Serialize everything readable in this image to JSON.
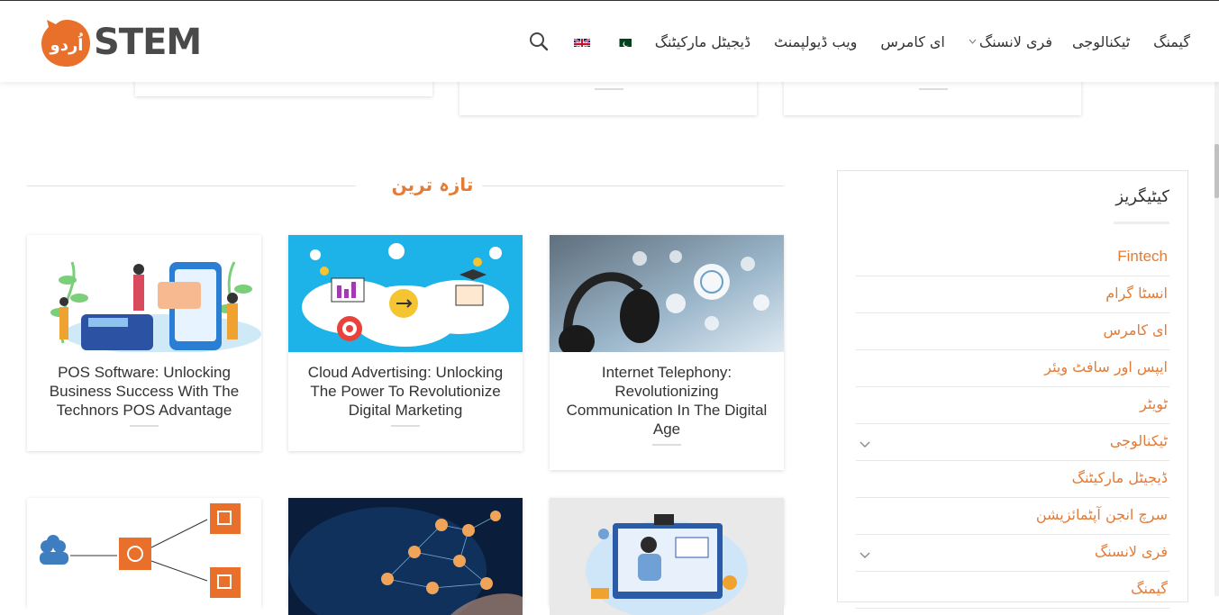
{
  "header": {
    "logo_text": "STEM",
    "logo_badge_text": "اُردو",
    "brand_color": "#e57b35",
    "nav": [
      {
        "label": "گیمنگ",
        "has_dropdown": false
      },
      {
        "label": "ٹیکنالوجی",
        "has_dropdown": false
      },
      {
        "label": "فری لانسنگ",
        "has_dropdown": true
      },
      {
        "label": "ای کامرس",
        "has_dropdown": false
      },
      {
        "label": "ویب ڈیولپمنٹ",
        "has_dropdown": false
      },
      {
        "label": "ڈیجیٹل مارکیٹنگ",
        "has_dropdown": false
      }
    ],
    "flags": [
      "pakistan-flag-icon",
      "uk-flag-icon"
    ],
    "search_icon": "search-icon"
  },
  "latest": {
    "title": "تازہ ترین",
    "posts": [
      {
        "title": "POS Software: Unlocking Business Success With The Technors POS Advantage",
        "image": "payment-terminal-illustration"
      },
      {
        "title": "Cloud Advertising: Unlocking The Power To Revolutionize Digital Marketing",
        "image": "cloud-marketing-illustration"
      },
      {
        "title": "Internet Telephony: Revolutionizing Communication In The Digital Age",
        "image": "headset-photo"
      },
      {
        "title": "",
        "image": "load-balancer-diagram"
      },
      {
        "title": "",
        "image": "network-globe-photo"
      },
      {
        "title": "",
        "image": "online-teacher-illustration"
      }
    ]
  },
  "sidebar": {
    "heading": "کیٹیگریز",
    "categories": [
      {
        "label": "Fintech",
        "has_children": false
      },
      {
        "label": "انسٹا گرام",
        "has_children": false
      },
      {
        "label": "ای کامرس",
        "has_children": false
      },
      {
        "label": "ایپس اور سافٹ ویئر",
        "has_children": false
      },
      {
        "label": "ٹویٹر",
        "has_children": false
      },
      {
        "label": "ٹیکنالوجی",
        "has_children": true
      },
      {
        "label": "ڈیجیٹل مارکیٹنگ",
        "has_children": false
      },
      {
        "label": "سرچ انجن آپٹمائزیشن",
        "has_children": false
      },
      {
        "label": "فری لانسنگ",
        "has_children": true
      },
      {
        "label": "گیمنگ",
        "has_children": false
      }
    ]
  }
}
